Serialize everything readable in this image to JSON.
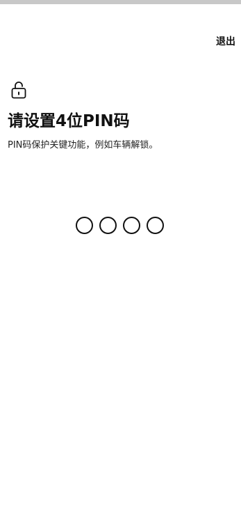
{
  "header": {
    "exit_label": "退出"
  },
  "main": {
    "icon": "lock-icon",
    "title": "请设置4位PIN码",
    "subtitle": "PIN码保护关键功能，例如车辆解锁。",
    "pin_length": 4,
    "pin_filled": 0
  }
}
